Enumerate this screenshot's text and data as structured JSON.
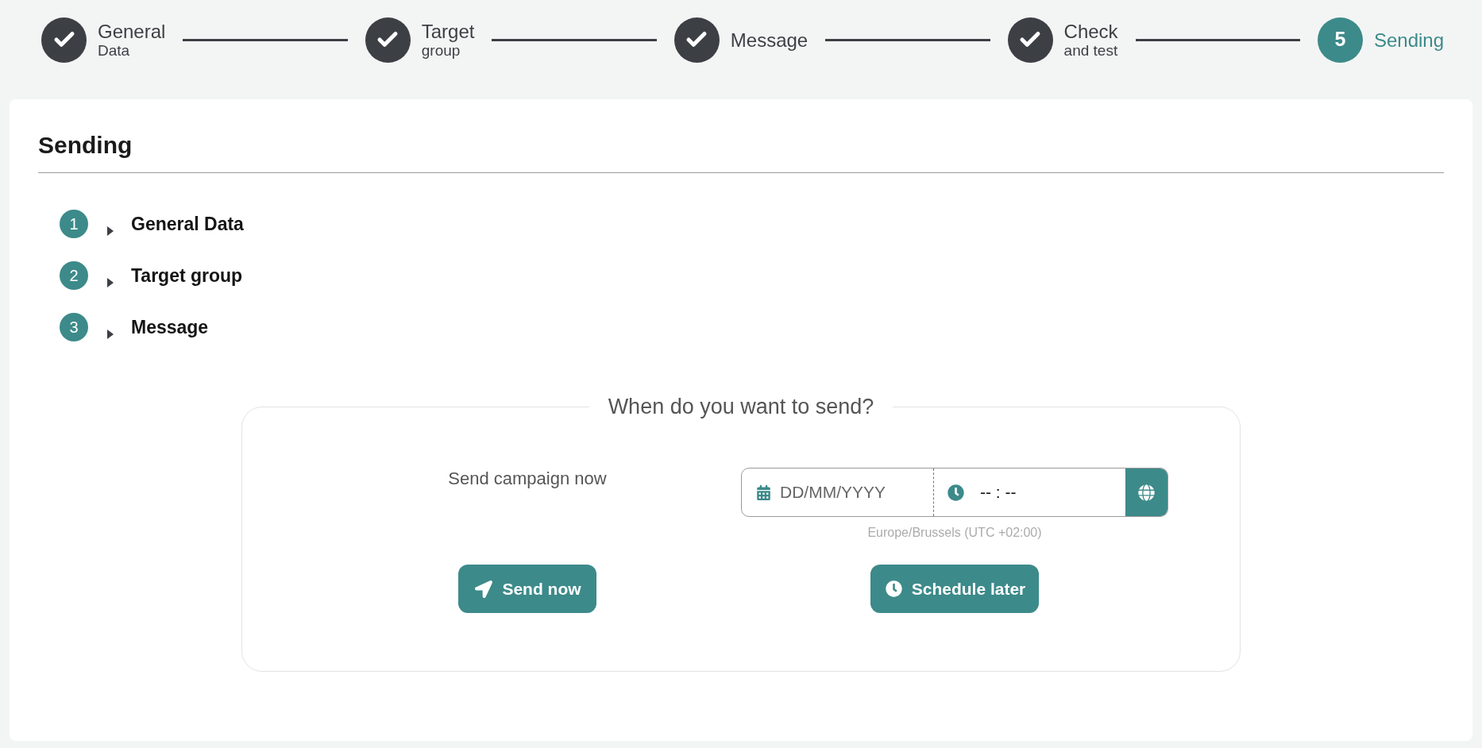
{
  "steps": [
    {
      "title": "General",
      "subtitle": "Data",
      "completed": true,
      "selected": false
    },
    {
      "title": "Target",
      "subtitle": "group",
      "completed": true,
      "selected": false
    },
    {
      "title": "Message",
      "completed": true,
      "selected": false
    },
    {
      "title": "Check",
      "subtitle": "and test",
      "completed": true,
      "selected": false
    },
    {
      "number": "5",
      "title": "Sending",
      "completed": false,
      "selected": true
    }
  ],
  "section": {
    "title": "Sending",
    "summary": [
      {
        "number": "1",
        "label": "General Data",
        "expanded": false
      },
      {
        "number": "2",
        "label": "Target group",
        "expanded": false
      },
      {
        "number": "3",
        "label": "Message",
        "expanded": false
      }
    ]
  },
  "schedule": {
    "legend": "When do you want to send?",
    "now": {
      "label": "Send campaign now",
      "button": "Send now"
    },
    "later": {
      "date": {
        "placeholder": "DD/MM/YYYY"
      },
      "time": {
        "value": "-- : --"
      },
      "timezone": "Europe/Brussels (UTC +02:00)",
      "button": "Schedule later"
    }
  }
}
